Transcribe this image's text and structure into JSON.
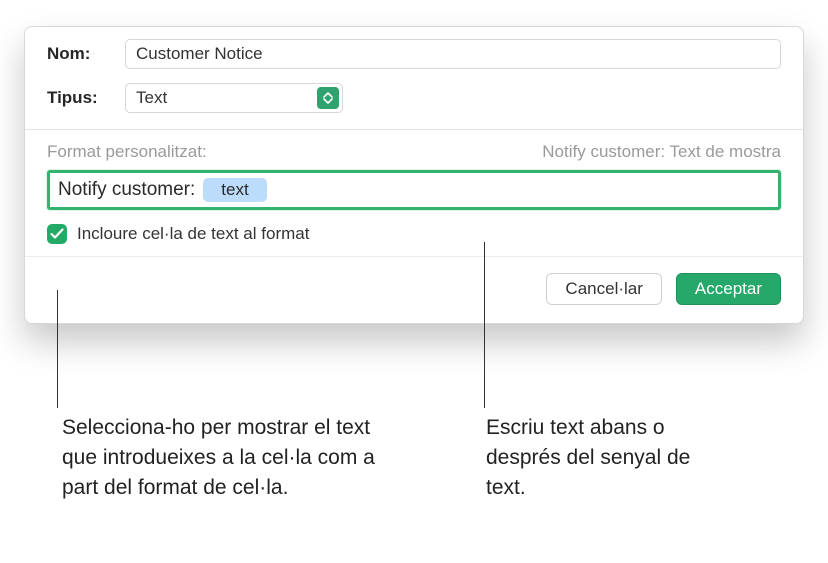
{
  "form": {
    "name_label": "Nom:",
    "name_value": "Customer Notice",
    "type_label": "Tipus:",
    "type_value": "Text"
  },
  "section": {
    "custom_format_label": "Format personalitzat:",
    "sample_text": "Notify customer: Text de mostra",
    "format_prefix": "Notify customer:",
    "token_label": "text"
  },
  "checkbox": {
    "include_label": "Incloure cel·la de text al format"
  },
  "buttons": {
    "cancel": "Cancel·lar",
    "accept": "Acceptar"
  },
  "callouts": {
    "left": "Selecciona-ho per mostrar el text que introdueixes a la cel·la com a part del format de cel·la.",
    "right": "Escriu text abans o després del senyal de text."
  }
}
